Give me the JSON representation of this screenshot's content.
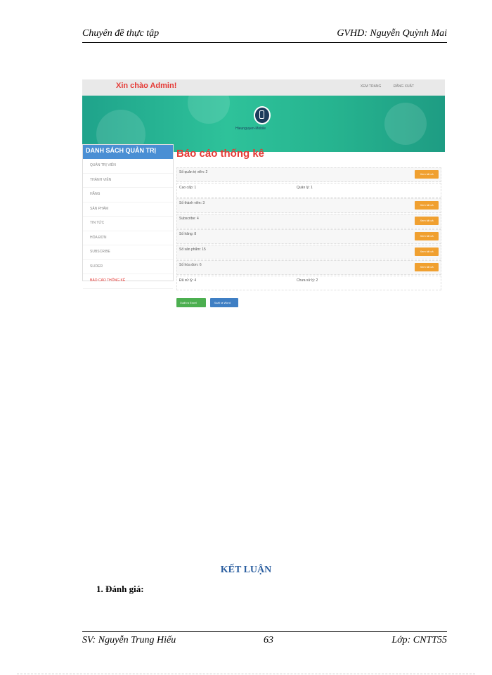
{
  "header": {
    "left": "Chuyên đề thực tập",
    "right": "GVHD:  Nguyễn Quỳnh Mai"
  },
  "footer": {
    "left": "SV: Nguyễn Trung Hiếu",
    "center": "63",
    "right": "Lớp: CNTT55"
  },
  "app": {
    "greeting": "Xin chào Admin!",
    "top_links": [
      "XEM TRANG",
      "ĐĂNG XUẤT"
    ],
    "logo_text": "Hieunguyen-Mobile",
    "sidebar": {
      "title": "DANH SÁCH QUẢN TRỊ",
      "items": [
        "QUẢN TRỊ VIÊN",
        "THÀNH VIÊN",
        "HÃNG",
        "SẢN PHẨM",
        "TIN TỨC",
        "HÓA ĐƠN",
        "SUBSCRIBE",
        "SLIDER",
        "BÁO CÁO THỐNG KÊ"
      ]
    },
    "main_title": "Báo cáo thống kê",
    "view_all_label": "Xem tất cả",
    "rows": [
      {
        "text": "Số quản trị viên: 2",
        "button": true
      },
      {
        "text": "Cao cấp: 1",
        "text2": "Quản lý: 1",
        "button": false
      },
      {
        "text": "Số thành viên: 3",
        "button": true
      },
      {
        "text": "Subscribe: 4",
        "button": true
      },
      {
        "text": "Số hãng: 8",
        "button": true
      },
      {
        "text": "Số sản phẩm: 15",
        "button": true
      },
      {
        "text": "Số hóa đơn: 6",
        "button": true
      },
      {
        "text": "Đã xử lý: 4",
        "text2": "Chưa xử lý: 2",
        "button": false
      }
    ],
    "export_excel": "Xuất ra Excel",
    "export_word": "Xuất ra Word"
  },
  "section_heading": "KẾT LUẬN",
  "subsection": "1.  Đánh giá:"
}
